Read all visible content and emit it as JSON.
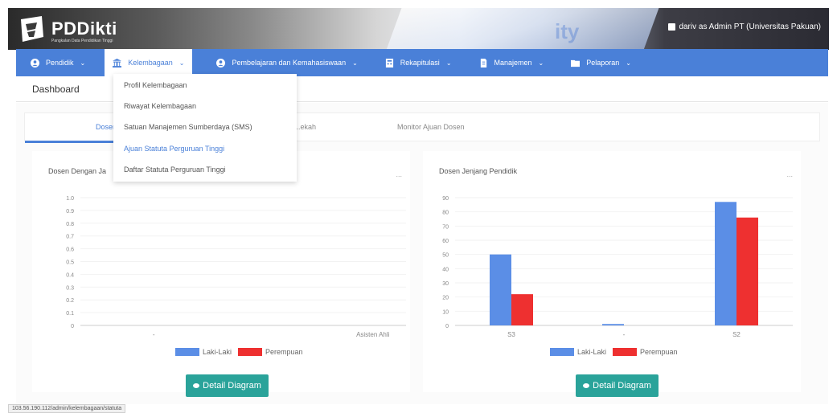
{
  "header": {
    "logo_text": "PDDikti",
    "logo_subtitle": "Pangkalan Data Pendidikan Tinggi",
    "user_label": "dariv as Admin PT (Universitas Pakuan)"
  },
  "nav": {
    "items": [
      {
        "label": "Pendidik",
        "icon": "user-circle-icon"
      },
      {
        "label": "Kelembagaan",
        "icon": "institution-icon"
      },
      {
        "label": "Pembelajaran dan Kemahasiswaan",
        "icon": "user-circle-icon"
      },
      {
        "label": "Rekapitulasi",
        "icon": "calculator-icon"
      },
      {
        "label": "Manajemen",
        "icon": "document-icon"
      },
      {
        "label": "Pelaporan",
        "icon": "folder-icon"
      }
    ],
    "active_index": 1
  },
  "dropdown": {
    "items": [
      {
        "label": "Profil Kelembagaan"
      },
      {
        "label": "Riwayat Kelembagaan"
      },
      {
        "label": "Satuan Manajemen Sumberdaya (SMS)"
      },
      {
        "label": "Ajuan Statuta Perguruan Tinggi"
      },
      {
        "label": "Daftar Statuta Perguruan Tinggi"
      }
    ],
    "highlighted_index": 3
  },
  "dashboard": {
    "title": "Dashboard"
  },
  "tabs": [
    {
      "label": "Dosen"
    },
    {
      "label": "...ekah"
    },
    {
      "label": "Monitor Ajuan Dosen"
    }
  ],
  "panels": {
    "left": {
      "title": "Dosen Dengan Ja",
      "menu": "...",
      "legend": [
        "Laki-Laki",
        "Perempuan"
      ],
      "button": "Detail Diagram"
    },
    "right": {
      "title": "Dosen Jenjang Pendidik",
      "menu": "...",
      "legend": [
        "Laki-Laki",
        "Perempuan"
      ],
      "button": "Detail Diagram"
    }
  },
  "colors": {
    "male": "#5b8ee6",
    "female": "#ee3030",
    "accent": "#4a80d8",
    "button": "#2aa39a"
  },
  "status_url": "103.56.190.112/admin/kelembagaan/statuta",
  "chart_data": [
    {
      "type": "bar",
      "title": "Dosen Dengan Ja",
      "categories": [
        "-",
        "Asisten Ahli"
      ],
      "series": [
        {
          "name": "Laki-Laki",
          "values": [
            0,
            0
          ]
        },
        {
          "name": "Perempuan",
          "values": [
            0,
            0
          ]
        }
      ],
      "yticks": [
        "1.0",
        "0.9",
        "0.8",
        "0.7",
        "0.6",
        "0.5",
        "0.4",
        "0.3",
        "0.2",
        "0.1",
        "0"
      ],
      "ylim": [
        0,
        1.0
      ],
      "legend_position": "bottom"
    },
    {
      "type": "bar",
      "title": "Dosen Jenjang Pendidik",
      "categories": [
        "S3",
        "-",
        "S2"
      ],
      "series": [
        {
          "name": "Laki-Laki",
          "values": [
            50,
            1,
            87
          ]
        },
        {
          "name": "Perempuan",
          "values": [
            22,
            0,
            76
          ]
        }
      ],
      "yticks": [
        "90",
        "80",
        "70",
        "60",
        "50",
        "40",
        "30",
        "20",
        "10",
        "0"
      ],
      "ylim": [
        0,
        90
      ],
      "legend_position": "bottom"
    }
  ]
}
